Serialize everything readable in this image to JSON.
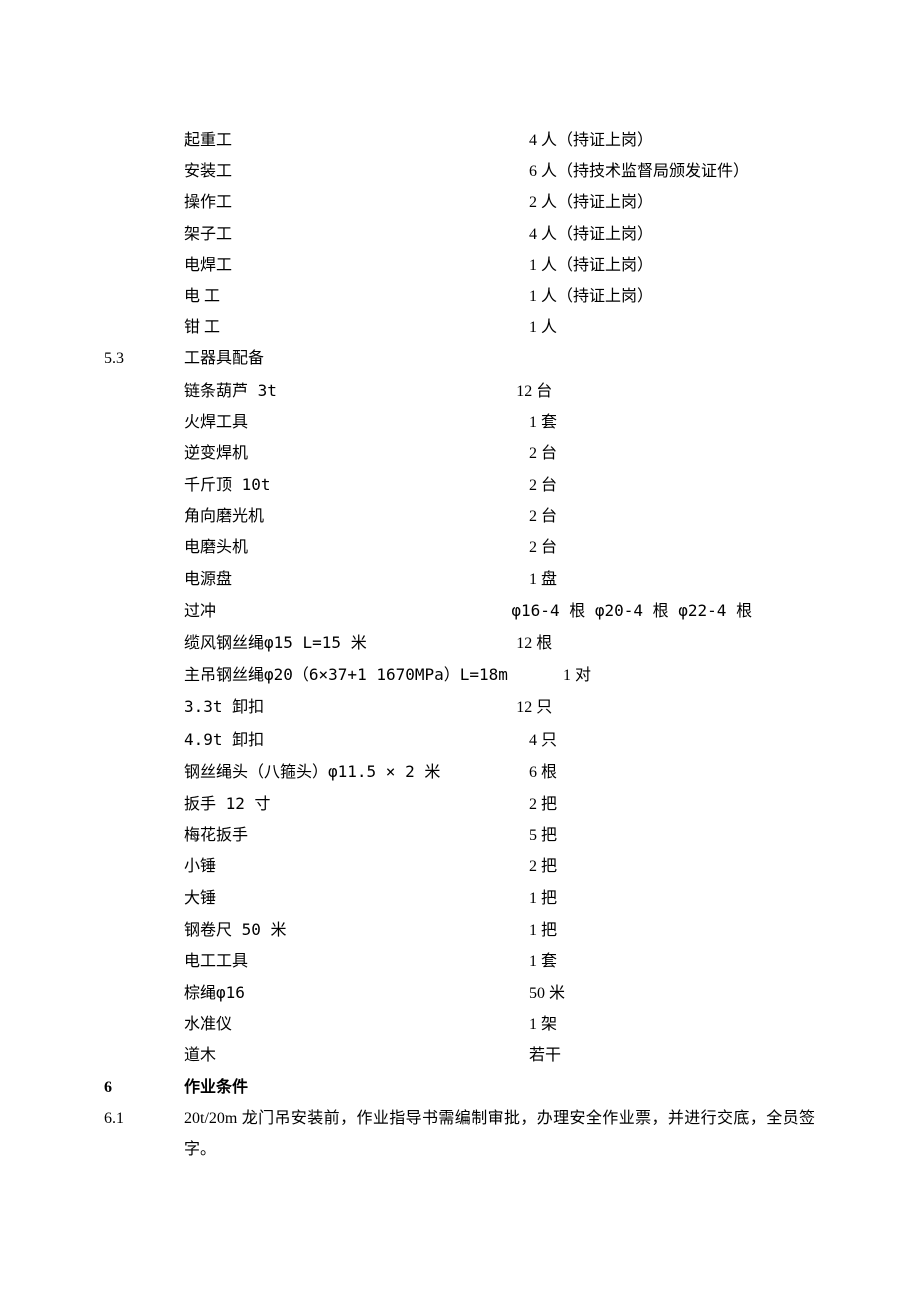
{
  "personnel": [
    {
      "label": "起重工",
      "value": "4 人（持证上岗）"
    },
    {
      "label": "安装工",
      "value": "6 人（持技术监督局颁发证件）"
    },
    {
      "label": "操作工",
      "value": "2 人（持证上岗）"
    },
    {
      "label": "架子工",
      "value": "4 人（持证上岗）"
    },
    {
      "label": "电焊工",
      "value": "1 人（持证上岗）"
    },
    {
      "label": "电  工",
      "value": "1 人（持证上岗）"
    },
    {
      "label": "钳  工",
      "value": "1 人"
    }
  ],
  "section53": {
    "num": "5.3",
    "title": "工器具配备"
  },
  "tools": [
    {
      "label": "链条葫芦 3t",
      "value": "12 台"
    },
    {
      "label": "火焊工具",
      "value": "1 套"
    },
    {
      "label": "逆变焊机",
      "value": "2 台"
    },
    {
      "label": "千斤顶 10t",
      "value": "2 台"
    },
    {
      "label": "角向磨光机",
      "value": "2 台"
    },
    {
      "label": "电磨头机",
      "value": "2 台"
    },
    {
      "label": "电源盘",
      "value": "1 盘"
    },
    {
      "label": "过冲",
      "value": "φ16-4 根   φ20-4 根   φ22-4 根"
    },
    {
      "label": "缆风钢丝绳φ15  L=15 米",
      "value": "12 根"
    },
    {
      "label": "主吊钢丝绳φ20（6×37+1 1670MPa）L=18m",
      "value": "1 对"
    },
    {
      "label": "3.3t 卸扣",
      "value": "12 只"
    },
    {
      "label": "4.9t 卸扣",
      "value": "4 只"
    },
    {
      "label": "钢丝绳头（八箍头）φ11.5 ×  2 米",
      "value": "6 根"
    },
    {
      "label": "扳手 12 寸",
      "value": "2 把"
    },
    {
      "label": "梅花扳手",
      "value": "5 把"
    },
    {
      "label": "小锤",
      "value": "2 把"
    },
    {
      "label": "大锤",
      "value": "1 把"
    },
    {
      "label": "钢卷尺 50 米",
      "value": "1 把"
    },
    {
      "label": "电工工具",
      "value": "1 套"
    },
    {
      "label": "棕绳φ16",
      "value": "50 米"
    },
    {
      "label": "水准仪",
      "value": "1 架"
    },
    {
      "label": "道木",
      "value": "若干"
    }
  ],
  "section6": {
    "num": "6",
    "title": "作业条件"
  },
  "section61": {
    "num": "6.1",
    "body": "20t/20m 龙门吊安装前，作业指导书需编制审批，办理安全作业票，并进行交底，全员签字。"
  }
}
